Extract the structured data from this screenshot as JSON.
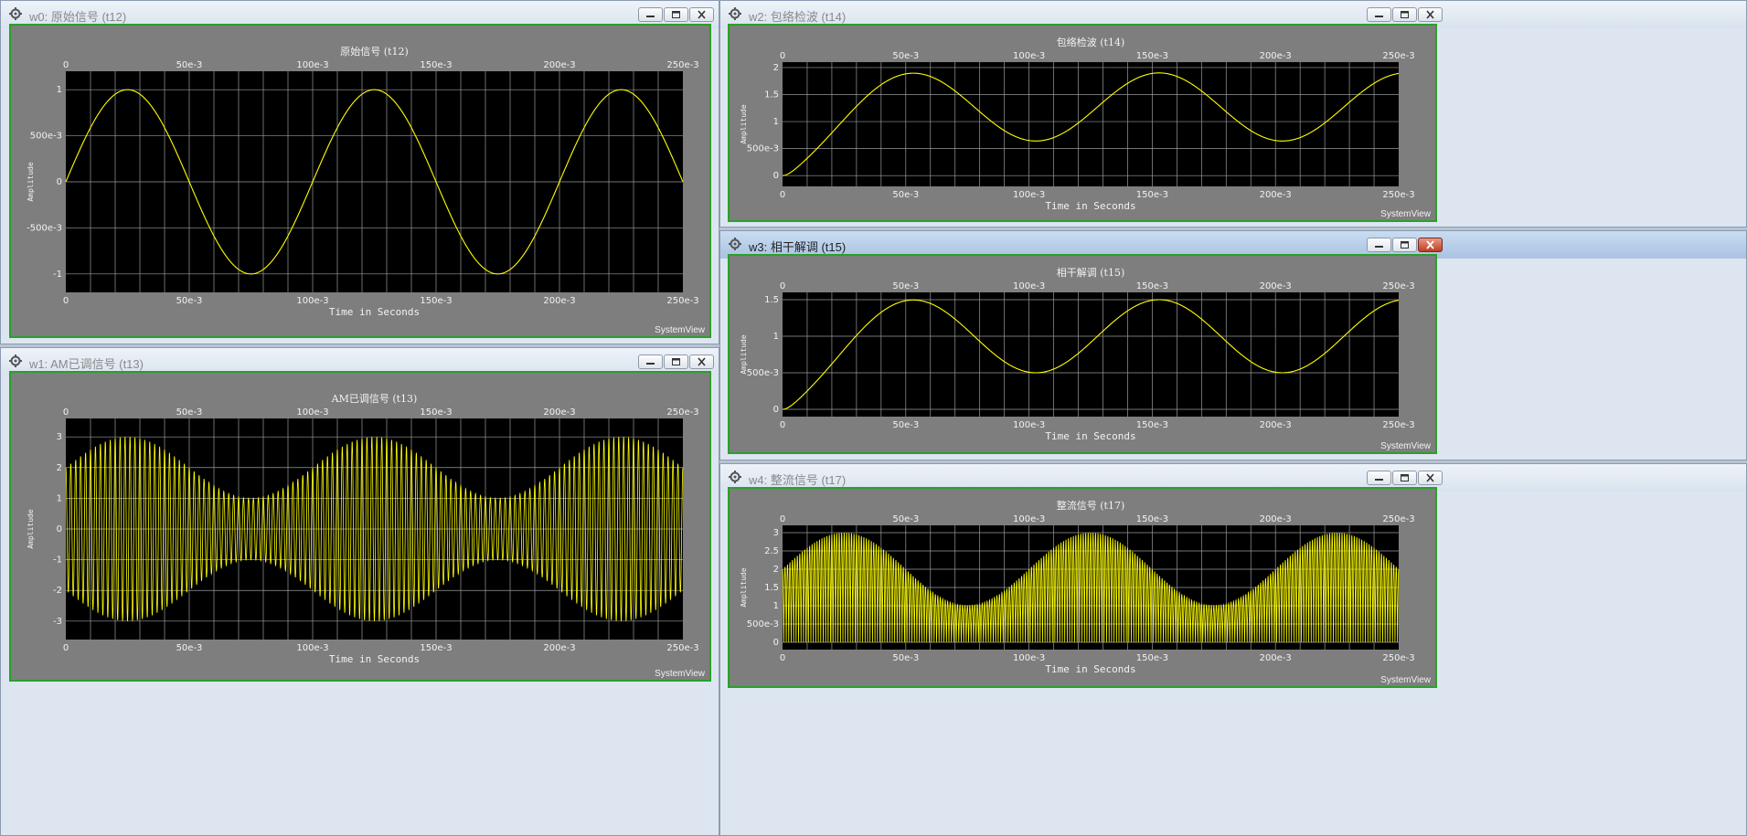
{
  "windows": [
    {
      "id": "w0",
      "title": "w0: 原始信号 (t12)",
      "active": false
    },
    {
      "id": "w1",
      "title": "w1: AM已调信号 (t13)",
      "active": false
    },
    {
      "id": "w2",
      "title": "w2: 包络检波 (t14)",
      "active": false
    },
    {
      "id": "w3",
      "title": "w3: 相干解调 (t15)",
      "active": true
    },
    {
      "id": "w4",
      "title": "w4: 整流信号 (t17)",
      "active": false
    }
  ],
  "brand_label": "SystemView",
  "colors": {
    "trace": "#ffff00",
    "plot_bg": "#000000",
    "panel_bg": "#7e7e7e",
    "grid": "#9a9a9a",
    "frame": "#2aa02a"
  },
  "chart_data": [
    {
      "id": "t12",
      "type": "line",
      "title": "原始信号 (t12)",
      "xlabel": "Time in Seconds",
      "ylabel": "Amplitude",
      "x_ticks": [
        "0",
        "50e-3",
        "100e-3",
        "150e-3",
        "200e-3",
        "250e-3"
      ],
      "y_ticks": [
        "-1",
        "-500e-3",
        "0",
        "500e-3",
        "1"
      ],
      "xlim": [
        0,
        0.25
      ],
      "ylim": [
        -1.2,
        1.2
      ],
      "grid": true,
      "x_grid_lines": 25,
      "series": [
        {
          "type": "sine",
          "offset": 0,
          "amplitude": 1,
          "mod_depth": 0,
          "freq_hz": 10,
          "carrier_hz": 0,
          "rectified": false
        }
      ],
      "samples": [
        [
          0,
          0
        ],
        [
          0.025,
          1
        ],
        [
          0.05,
          0
        ],
        [
          0.075,
          -1
        ],
        [
          0.1,
          0
        ],
        [
          0.125,
          1
        ],
        [
          0.15,
          0
        ],
        [
          0.175,
          -1
        ],
        [
          0.2,
          0
        ],
        [
          0.225,
          1
        ],
        [
          0.25,
          0
        ]
      ]
    },
    {
      "id": "t13",
      "type": "line",
      "title": "AM已调信号 (t13)",
      "xlabel": "Time in Seconds",
      "ylabel": "Amplitude",
      "x_ticks": [
        "0",
        "50e-3",
        "100e-3",
        "150e-3",
        "200e-3",
        "250e-3"
      ],
      "y_ticks": [
        "-3",
        "-2",
        "-1",
        "0",
        "1",
        "2",
        "3"
      ],
      "xlim": [
        0,
        0.25
      ],
      "ylim": [
        -3.6,
        3.6
      ],
      "grid": true,
      "x_grid_lines": 25,
      "series": [
        {
          "type": "am",
          "offset": 2,
          "amplitude": 1,
          "freq_hz": 10,
          "carrier_hz": 500,
          "rectified": false
        }
      ],
      "envelope_samples": [
        [
          0,
          2
        ],
        [
          0.025,
          3
        ],
        [
          0.075,
          1
        ],
        [
          0.125,
          3
        ],
        [
          0.175,
          1
        ],
        [
          0.225,
          3
        ],
        [
          0.25,
          2
        ]
      ]
    },
    {
      "id": "t14",
      "type": "line",
      "title": "包络检波 (t14)",
      "xlabel": "Time in Seconds",
      "ylabel": "Amplitude",
      "x_ticks": [
        "0",
        "50e-3",
        "100e-3",
        "150e-3",
        "200e-3",
        "250e-3"
      ],
      "y_ticks": [
        "0",
        "500e-3",
        "1",
        "1.5",
        "2"
      ],
      "xlim": [
        0,
        0.25
      ],
      "ylim": [
        -0.2,
        2.1
      ],
      "grid": true,
      "x_grid_lines": 25,
      "series": [
        {
          "type": "filtered",
          "offset": 1.27,
          "amplitude": 0.63,
          "freq_hz": 10,
          "phase_deg": -100,
          "settle_tau_s": 0.0065
        }
      ],
      "samples": [
        [
          0,
          0
        ],
        [
          0.0115,
          1.4
        ],
        [
          0.032,
          1.9
        ],
        [
          0.082,
          0.64
        ],
        [
          0.132,
          1.9
        ],
        [
          0.182,
          0.64
        ],
        [
          0.232,
          1.9
        ],
        [
          0.25,
          1.52
        ]
      ]
    },
    {
      "id": "t15",
      "type": "line",
      "title": "相干解调 (t15)",
      "xlabel": "Time in Seconds",
      "ylabel": "Amplitude",
      "x_ticks": [
        "0",
        "50e-3",
        "100e-3",
        "150e-3",
        "200e-3",
        "250e-3"
      ],
      "y_ticks": [
        "0",
        "500e-3",
        "1",
        "1.5"
      ],
      "xlim": [
        0,
        0.25
      ],
      "ylim": [
        -0.1,
        1.6
      ],
      "grid": true,
      "x_grid_lines": 25,
      "series": [
        {
          "type": "filtered",
          "offset": 1.0,
          "amplitude": 0.5,
          "freq_hz": 10,
          "phase_deg": -100,
          "settle_tau_s": 0.0065
        }
      ],
      "samples": [
        [
          0,
          0
        ],
        [
          0.0115,
          1.15
        ],
        [
          0.032,
          1.5
        ],
        [
          0.082,
          0.5
        ],
        [
          0.132,
          1.5
        ],
        [
          0.182,
          0.5
        ],
        [
          0.232,
          1.5
        ],
        [
          0.25,
          1.2
        ]
      ]
    },
    {
      "id": "t17",
      "type": "line",
      "title": "整流信号 (t17)",
      "xlabel": "Time in Seconds",
      "ylabel": "Amplitude",
      "x_ticks": [
        "0",
        "50e-3",
        "100e-3",
        "150e-3",
        "200e-3",
        "250e-3"
      ],
      "y_ticks": [
        "0",
        "500e-3",
        "1",
        "1.5",
        "2",
        "2.5",
        "3"
      ],
      "xlim": [
        0,
        0.25
      ],
      "ylim": [
        -0.2,
        3.2
      ],
      "grid": true,
      "x_grid_lines": 25,
      "series": [
        {
          "type": "am",
          "offset": 2,
          "amplitude": 1,
          "freq_hz": 10,
          "carrier_hz": 500,
          "rectified": true
        }
      ],
      "envelope_samples": [
        [
          0,
          2
        ],
        [
          0.025,
          3
        ],
        [
          0.075,
          1
        ],
        [
          0.125,
          3
        ],
        [
          0.175,
          1
        ],
        [
          0.225,
          3
        ],
        [
          0.25,
          2
        ]
      ]
    }
  ]
}
